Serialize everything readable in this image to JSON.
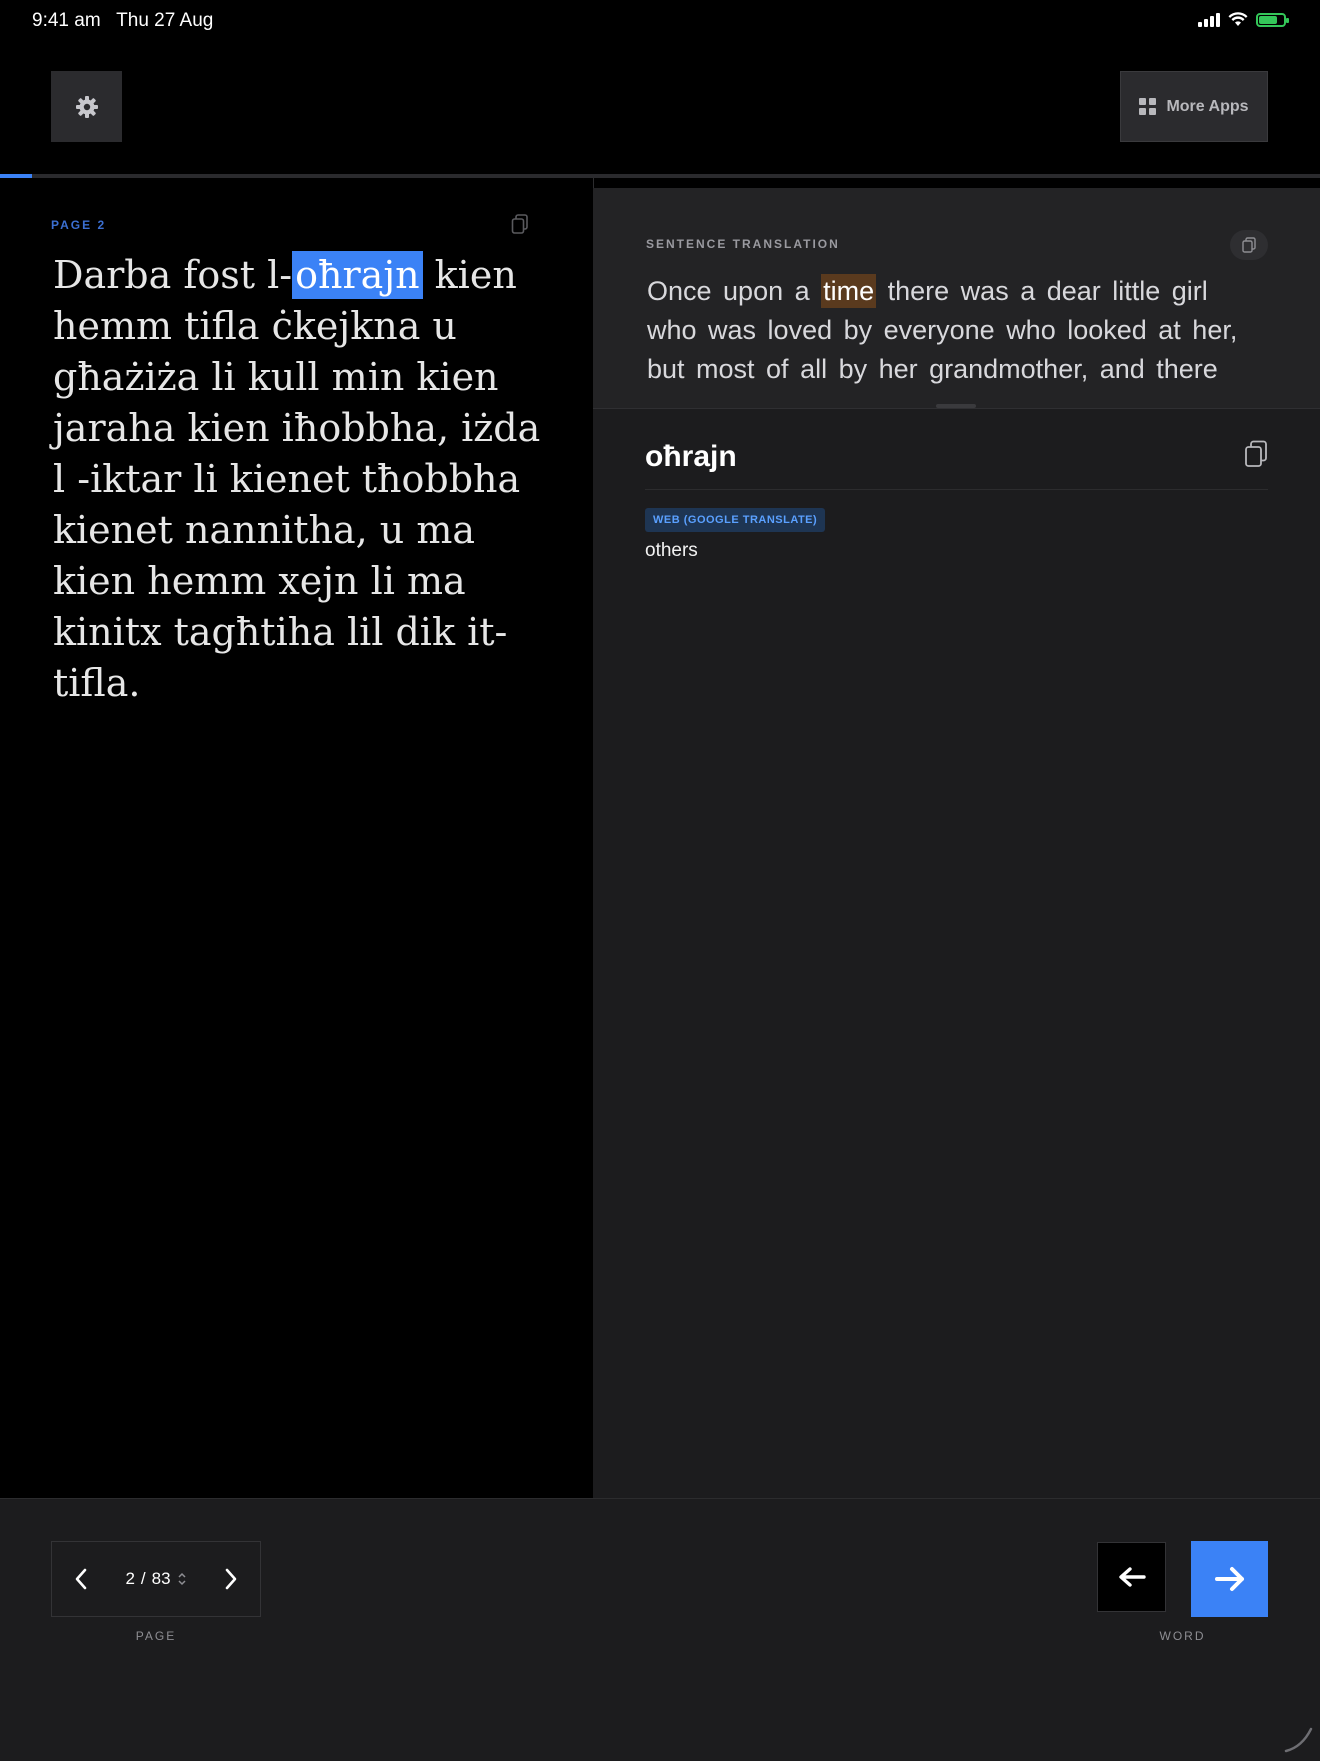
{
  "status_bar": {
    "time": "9:41 am",
    "date": "Thu 27 Aug",
    "icons": [
      "signal-icon",
      "wifi-icon",
      "battery-charging-icon"
    ]
  },
  "toolbar": {
    "settings_icon": "gear-icon",
    "more_apps_label": "More Apps",
    "more_apps_icon": "grid-icon"
  },
  "reading_progress": 0.024,
  "reader": {
    "page_label": "PAGE 2",
    "text_before": "Darba fost l-",
    "selected_word": "oħrajn",
    "text_after": " kien hemm tifla ċkejkna u għażiża li kull min kien jaraha kien iħobbha, iżda l -iktar li kienet tħobbha kienet nannitha, u ma kien hemm xejn li ma kinitx tagħtiha lil dik it-tifla."
  },
  "sentence_translation": {
    "label": "SENTENCE TRANSLATION",
    "text_before": "Once upon a ",
    "highlight": "time",
    "text_after": " there was a dear little girl who was loved by everyone who looked at her, but most of all by her grandmother, and there"
  },
  "word_panel": {
    "word": "oħrajn",
    "source_badge": "WEB (GOOGLE TRANSLATE)",
    "translation": "others"
  },
  "pager": {
    "current": "2",
    "separator": "/",
    "total": "83",
    "label": "PAGE"
  },
  "word_nav": {
    "label": "WORD"
  },
  "colors": {
    "accent": "#3b82f6",
    "highlight_sentence": "#5a3a1e",
    "battery": "#34c759"
  }
}
